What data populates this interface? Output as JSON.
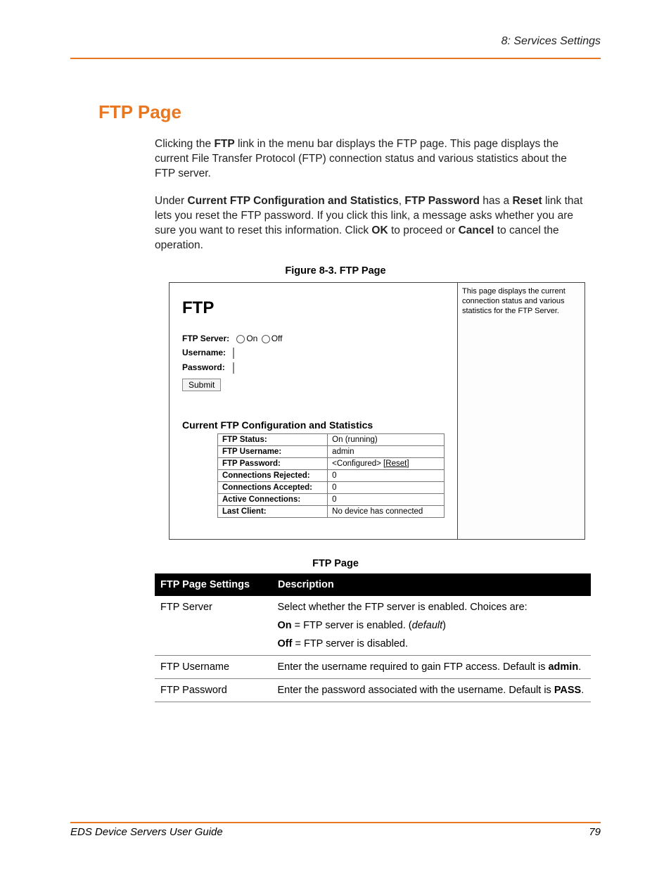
{
  "header": {
    "breadcrumb": "8: Services Settings"
  },
  "title": "FTP Page",
  "para1": {
    "pre": "Clicking the ",
    "b1": "FTP",
    "post": " link in the menu bar displays the FTP page. This page displays the current File Transfer Protocol (FTP) connection status and various statistics about the FTP server."
  },
  "para2": {
    "pre": "Under ",
    "b1": "Current FTP Configuration and Statistics",
    "mid1": ", ",
    "b2": "FTP Password",
    "mid2": " has a ",
    "b3": "Reset",
    "mid3": " link that lets you reset the FTP password. If you click this link, a message asks whether you are sure you want to reset this information. Click ",
    "b4": "OK",
    "mid4": " to proceed or ",
    "b5": "Cancel",
    "post": " to cancel the operation."
  },
  "figure": {
    "caption": "Figure 8-3. FTP Page",
    "side_note": "This page displays the current connection status and various statistics for the FTP Server.",
    "panel_title": "FTP",
    "form": {
      "server_label": "FTP Server:",
      "on_label": "On",
      "off_label": "Off",
      "username_label": "Username:",
      "password_label": "Password:",
      "submit_label": "Submit"
    },
    "stats_heading": "Current FTP Configuration and Statistics",
    "stats": {
      "rows": [
        {
          "key": "FTP Status:",
          "val": "On (running)"
        },
        {
          "key": "FTP Username:",
          "val": "admin"
        },
        {
          "key": "FTP Password:",
          "val_pre": "<Configured> [",
          "val_link": "Reset",
          "val_post": "]"
        },
        {
          "key": "Connections Rejected:",
          "val": "0"
        },
        {
          "key": "Connections Accepted:",
          "val": "0"
        },
        {
          "key": "Active Connections:",
          "val": "0"
        },
        {
          "key": "Last Client:",
          "val": "No device has connected"
        }
      ]
    }
  },
  "desc_table": {
    "caption": "FTP Page",
    "col1_header": "FTP Page Settings",
    "col2_header": "Description",
    "rows": [
      {
        "setting": "FTP Server",
        "desc_line1": "Select whether the FTP server is enabled. Choices are:",
        "opt1_b": "On",
        "opt1_rest": " = FTP server is enabled. (",
        "opt1_i": "default",
        "opt1_end": ")",
        "opt2_b": "Off",
        "opt2_rest": " = FTP server is disabled."
      },
      {
        "setting": "FTP Username",
        "desc_pre": "Enter the username required to gain FTP access. Default is ",
        "desc_b": "admin",
        "desc_post": "."
      },
      {
        "setting": "FTP Password",
        "desc_pre": "Enter the password associated with the username. Default is ",
        "desc_b": "PASS",
        "desc_post": "."
      }
    ]
  },
  "footer": {
    "left": "EDS Device Servers User Guide",
    "right": "79"
  }
}
